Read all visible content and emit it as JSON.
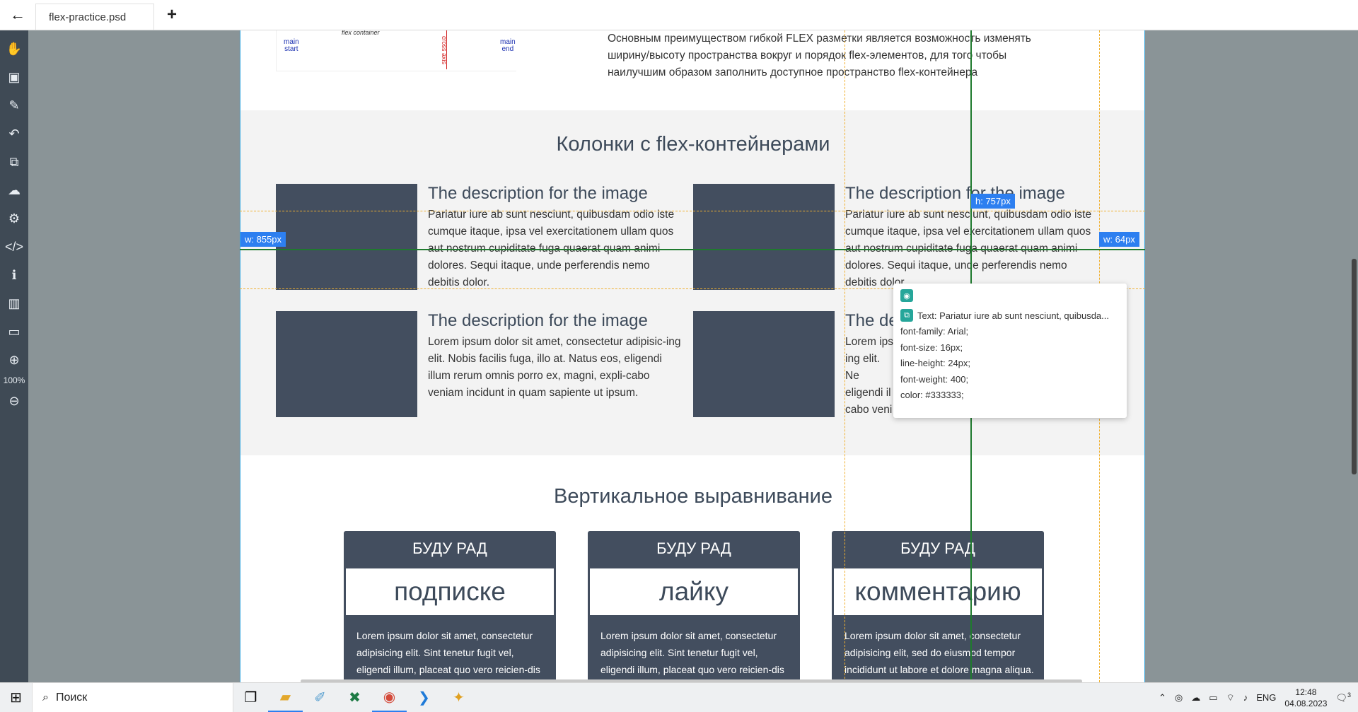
{
  "window": {
    "tab_title": "flex-practice.psd",
    "back_glyph": "←",
    "plus_glyph": "+"
  },
  "toolbar": {
    "tools": [
      "hand-icon",
      "artboard-icon",
      "eyedropper-icon",
      "undo-icon",
      "transform-icon",
      "cloud-download-icon",
      "gear-icon",
      "code-icon",
      "info-icon",
      "barcode-icon",
      "money-icon",
      "zoom-in-icon",
      "zoom-out-icon"
    ],
    "zoom": "100%"
  },
  "design": {
    "diagram": {
      "main_start": "main\nstart",
      "main_end": "main\nend",
      "flex_container": "flex container",
      "cross_axis": "cross axis"
    },
    "intro_text": "Основным преимуществом гибкой FLEX разметки является возможность изменять ширину/высоту пространства вокруг и порядок flex-элементов, для того чтобы наилучшим образом заполнить доступное пространство flex-контейнера",
    "columns_title": "Колонки с flex-контейнерами",
    "cards": [
      {
        "title": "The description for the image",
        "text": "Pariatur iure ab sunt nesciunt, quibusdam odio iste cumque itaque, ipsa vel exercitationem ullam quos aut nostrum cupiditate fuga quaerat quam animi dolores. Sequi itaque, unde perferendis nemo debitis dolor."
      },
      {
        "title": "The description for the image",
        "text": "Pariatur iure ab sunt nesciunt, quibusdam odio iste cumque itaque, ipsa vel exercitationem ullam quos aut nostrum cupiditate fuga quaerat quam animi dolores. Sequi itaque, unde perferendis nemo debitis dolor."
      },
      {
        "title": "The description for the image",
        "text": "Lorem ipsum dolor sit amet, consectetur adipisic-ing elit. Nobis facilis fuga, illo at. Natus eos, eligendi illum rerum omnis porro ex, magni, expli-cabo veniam incidunt in quam sapiente ut ipsum."
      },
      {
        "title": "The de",
        "text": "Lorem ips ing elit. Ne eligendi il cabo veni"
      }
    ],
    "vertical_title": "Вертикальное выравнивание",
    "boxes": [
      {
        "head": "БУДУ РАД",
        "big": "подписке",
        "body": "Lorem ipsum dolor sit amet, consectetur adipisicing elit. Sint tenetur fugit vel, eligendi illum, placeat quo vero reicien-dis consectetur"
      },
      {
        "head": "БУДУ РАД",
        "big": "лайку",
        "body": "Lorem ipsum dolor sit amet, consectetur adipisicing elit. Sint tenetur fugit vel, eligendi illum, placeat quo vero reicien-dis consectetur voluptatibus eius et"
      },
      {
        "head": "БУДУ РАД",
        "big": "комментарию",
        "body": "Lorem ipsum dolor sit amet, consectetur adipisicing elit, sed do eiusmod tempor incididunt ut labore et dolore magna aliqua. Quis ipsum suspendisse ultrices"
      }
    ]
  },
  "measures": {
    "width_left": "w: 855px",
    "height": "h: 757px",
    "width_right": "w: 64px"
  },
  "tooltip": {
    "text_line": "Text: Pariatur iure ab sunt nesciunt, quibusda...",
    "props": [
      "font-family: Arial;",
      "font-size: 16px;",
      "line-height: 24px;",
      "font-weight: 400;",
      "color: #333333;"
    ]
  },
  "taskbar": {
    "search_placeholder": "Поиск",
    "apps": [
      "task-view-icon",
      "file-explorer-icon",
      "paint-icon",
      "excel-icon",
      "chrome-icon",
      "vscode-icon",
      "tool-icon"
    ],
    "lang": "ENG",
    "time": "12:48",
    "date": "04.08.2023",
    "notifications": "3"
  },
  "colors": {
    "accent": "#2d7ff0",
    "toolbar_bg": "#3f4a55",
    "card_dark": "#434e5f",
    "guide_green": "#1f7a2e",
    "guide_orange": "#f0b030"
  }
}
